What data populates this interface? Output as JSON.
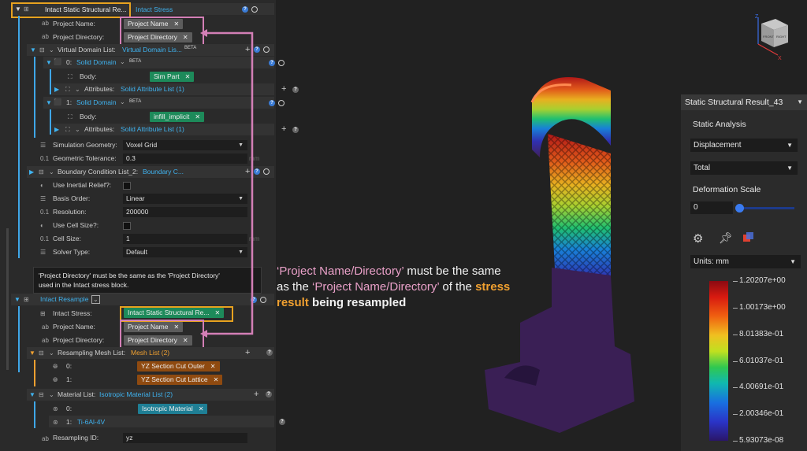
{
  "top_block": {
    "title": "Intact Static Structural Re...",
    "subtitle": "Intact Stress",
    "project_name_label": "Project Name:",
    "project_name_value": "Project Name",
    "project_dir_label": "Project Directory:",
    "project_dir_value": "Project Directory",
    "vdl_label": "Virtual Domain List:",
    "vdl_value": "Virtual Domain Lis...",
    "beta": "BETA",
    "domain0_index": "0:",
    "domain0_name": "Solid Domain",
    "domain0_body_label": "Body:",
    "domain0_body_value": "Sim Part",
    "attributes_label": "Attributes:",
    "domain0_attr_value": "Solid Attribute List (1)",
    "domain1_index": "1:",
    "domain1_name": "Solid Domain",
    "domain1_body_label": "Body:",
    "domain1_body_value": "infill_implicit",
    "domain1_attr_value": "Solid Attribute List (1)",
    "sim_geom_label": "Simulation Geometry:",
    "sim_geom_value": "Voxel Grid",
    "geo_tol_label": "Geometric Tolerance:",
    "geo_tol_value": "0.3",
    "unit_mm": "mm",
    "bcl_label": "Boundary Condition List_2:",
    "bcl_value": "Boundary C...",
    "inertial_label": "Use Inertial Relief?:",
    "basis_label": "Basis Order:",
    "basis_value": "Linear",
    "resolution_label": "Resolution:",
    "resolution_value": "200000",
    "use_cell_label": "Use Cell Size?:",
    "cell_size_label": "Cell Size:",
    "cell_size_value": "1",
    "solver_label": "Solver Type:",
    "solver_value": "Default"
  },
  "tooltip": {
    "line1": "'Project Directory' must be the same as the 'Project Directory'",
    "line2": "used in the Intact stress block."
  },
  "resample_block": {
    "title": "Intact Resample",
    "intact_stress_label": "Intact Stress:",
    "intact_stress_value": "Intact Static Structural Re...",
    "project_name_label": "Project Name:",
    "project_name_value": "Project Name",
    "project_dir_label": "Project Directory:",
    "project_dir_value": "Project Directory",
    "mesh_list_label": "Resampling Mesh List:",
    "mesh_list_value": "Mesh List (2)",
    "mesh0_index": "0:",
    "mesh0_value": "YZ Section Cut Outer",
    "mesh1_index": "1:",
    "mesh1_value": "YZ Section Cut Lattice",
    "material_list_label": "Material List:",
    "material_list_value": "Isotropic Material List (2)",
    "mat0_index": "0:",
    "mat0_value": "Isotropic Material",
    "mat1_index": "1:",
    "mat1_value": "Ti-6Al-4V",
    "resampling_id_label": "Resampling ID:",
    "resampling_id_value": "yz"
  },
  "annotation": {
    "l1_a": "‘Project Name/Directory’",
    "l1_b": " must be the same",
    "l2_a": "as the ",
    "l2_b": "‘Project Name/Directory’",
    "l2_c": " of the ",
    "l2_d": "stress",
    "l3_a": "result",
    "l3_b": " being resampled"
  },
  "viewcube": {
    "face_front": "FRONT",
    "face_right": "RIGHT",
    "axis_z": "Z",
    "axis_x": "X"
  },
  "right_panel": {
    "header": "Static Structural Result_43",
    "analysis": "Static Analysis",
    "field_select": "Displacement",
    "component_select": "Total",
    "deform_label": "Deformation Scale",
    "deform_value": "0",
    "deform_slider_fraction": 0.0,
    "units_select": "Units: mm",
    "colorbar_ticks": [
      "1.20207e+00",
      "1.00173e+00",
      "8.01383e-01",
      "6.01037e-01",
      "4.00691e-01",
      "2.00346e-01",
      "5.93073e-08"
    ]
  },
  "colors": {
    "accent_blue": "#3fb3f0",
    "highlight_orange": "#e7a21f",
    "highlight_pink": "#d37fb6",
    "note_orange": "#f0a030"
  }
}
